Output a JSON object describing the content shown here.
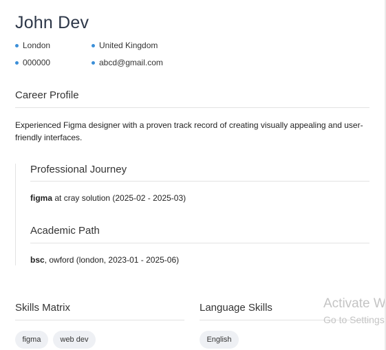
{
  "header": {
    "name": "John Dev",
    "contacts": [
      {
        "icon": "bullet-icon",
        "text": "London"
      },
      {
        "icon": "bullet-icon",
        "text": "United Kingdom"
      },
      {
        "icon": "bullet-icon",
        "text": "000000"
      },
      {
        "icon": "bullet-icon",
        "text": "abcd@gmail.com"
      }
    ]
  },
  "career": {
    "title": "Career Profile",
    "summary": "Experienced Figma designer with a proven track record of creating visually appealing and user-friendly interfaces."
  },
  "experience": {
    "title": "Professional Journey",
    "items": [
      {
        "role": "figma",
        "rest": " at cray solution (2025-02 - 2025-03)"
      }
    ]
  },
  "education": {
    "title": "Academic Path",
    "items": [
      {
        "degree": "bsc",
        "rest": ", owford (london, 2023-01 - 2025-06)"
      }
    ]
  },
  "skills": {
    "title": "Skills Matrix",
    "items": [
      "figma",
      "web dev"
    ]
  },
  "languages": {
    "title": "Language Skills",
    "items": [
      "English"
    ]
  },
  "watermark": {
    "line1": "Activate W",
    "line2": "Go to Settings"
  },
  "colors": {
    "accent": "#3b8fd8",
    "chip_bg": "#eef0f4",
    "rule": "#e2e2e2"
  }
}
